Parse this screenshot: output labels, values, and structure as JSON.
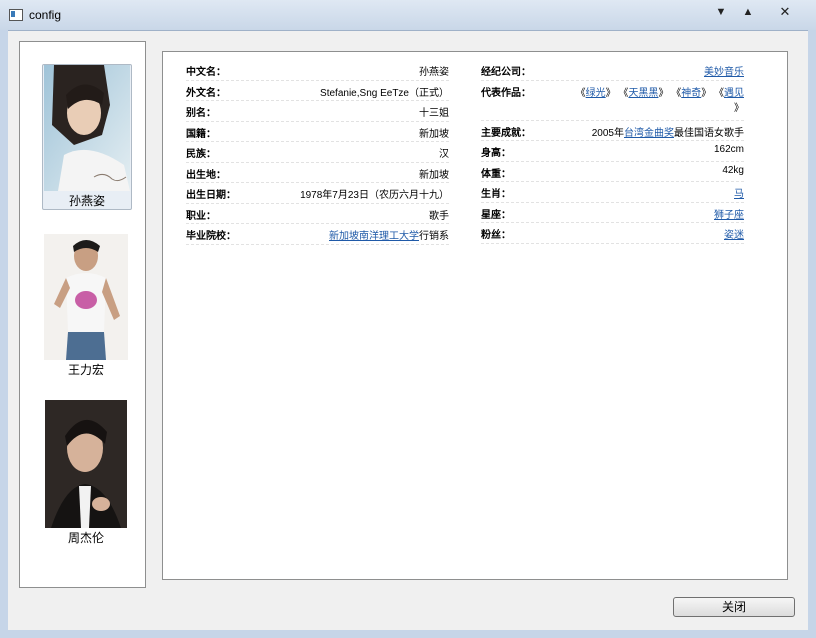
{
  "window": {
    "title": "config"
  },
  "people": [
    {
      "name": "孙燕姿",
      "selected": true
    },
    {
      "name": "王力宏",
      "selected": false
    },
    {
      "name": "周杰伦",
      "selected": false
    }
  ],
  "info": {
    "left": [
      {
        "label": "中文名：",
        "value": "孙燕姿"
      },
      {
        "label": "外文名：",
        "value": "Stefanie,Sng EeTze（正式）"
      },
      {
        "label": "别名：",
        "value": "十三姐"
      },
      {
        "label": "国籍：",
        "value": "新加坡"
      },
      {
        "label": "民族：",
        "value": "汉"
      },
      {
        "label": "出生地：",
        "value": "新加坡"
      },
      {
        "label": "出生日期：",
        "value": "1978年7月23日（农历六月十九）"
      },
      {
        "label": "职业：",
        "value": "歌手"
      },
      {
        "label": "毕业院校：",
        "link": "新加坡南洋理工大学",
        "suffix": "行销系"
      }
    ],
    "right": {
      "company_label": "经纪公司：",
      "company_link": "美妙音乐",
      "works_label": "代表作品：",
      "works": [
        "绿光",
        "天黑黑",
        "神奇",
        "遇见"
      ],
      "achieve_label": "主要成就：",
      "achieve_prefix": "2005年",
      "achieve_link": "台湾金曲奖",
      "achieve_suffix": "最佳国语女歌手",
      "height_label": "身高：",
      "height": "162cm",
      "weight_label": "体重：",
      "weight": "42kg",
      "zodiac_label": "生肖：",
      "zodiac": "马",
      "star_label": "星座：",
      "star": "狮子座",
      "fans_label": "粉丝：",
      "fans": "姿迷"
    }
  },
  "buttons": {
    "close": "关闭"
  }
}
